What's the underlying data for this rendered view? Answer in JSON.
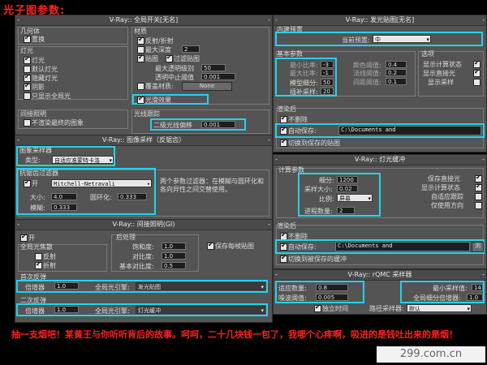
{
  "page_title": "光子图参数:",
  "global_switches": {
    "header": "V-Ray:: 全局开关[无名]",
    "geometry_group": "几何体",
    "displacement": "置换",
    "lights_group": "灯光",
    "lights": "灯光",
    "default_lights": "默认灯光",
    "hidden_lights": "隐藏灯光",
    "shadows": "阴影",
    "show_gi_only": "只显示全局光",
    "indirect_group": "间接照明",
    "no_render_final": "不渲染最终的图象",
    "materials_group": "材质",
    "reflect_refract": "反射/折射",
    "max_depth_label": "最大深度",
    "max_depth_value": "2",
    "maps": "贴图",
    "filter_maps": "过滤贴图",
    "max_transp_label": "最大透明级别",
    "max_transp_value": "50",
    "transp_cutoff_label": "透明中止阈值",
    "transp_cutoff_value": "0.001",
    "override_mtl": "覆盖材质:",
    "override_mtl_btn": "None",
    "glossy_effects": "光滑效果",
    "raytracing_group": "光线跟踪",
    "secondary_bias_label": "二级光线偏移",
    "secondary_bias_value": "0.001"
  },
  "image_sampler": {
    "header": "V-Ray:: 图像采样（反锯齿）",
    "sampler_group": "图象采样器",
    "type_label": "类型:",
    "type_value": "自适应准蒙特卡洛",
    "aa_group": "抗锯齿过滤器",
    "on_label": "开",
    "filter_value": "Mitchell-Netravali",
    "filter_desc": "两个参数过滤器：在模糊与圆环化和各向异性之间交替使用。",
    "size_label": "大小:",
    "size_value": "4.0",
    "ringing_label": "圆环化:",
    "ringing_value": "0.333",
    "blur_label": "模糊:",
    "blur_value": "0.333"
  },
  "indirect_illum": {
    "header": "V-Ray:: 间接照明(GI)",
    "on_label": "开",
    "caustics_group": "全局光焦散",
    "reflective": "反射",
    "refractive": "折射",
    "post_group": "后处理",
    "saturation_label": "饱和度:",
    "saturation_value": "1.0",
    "contrast_label": "对比度:",
    "contrast_value": "1.0",
    "contrast_base_label": "基本对比度:",
    "contrast_base_value": "0.5",
    "save_maps": "保存每帧贴图",
    "primary_group": "首次反弹",
    "primary_mult_label": "倍增器",
    "primary_mult_value": "1.0",
    "primary_engine_label": "全局光引擎:",
    "primary_engine_value": "发光贴图",
    "secondary_group": "二次反弹",
    "secondary_mult_label": "倍增器",
    "secondary_mult_value": "1.0",
    "secondary_engine_label": "全局光引擎:",
    "secondary_engine_value": "灯光缓冲"
  },
  "irradiance_map": {
    "header": "V-Ray:: 发光贴图[无名]",
    "builtin_group": "内建预置",
    "current_preset_label": "当前预置:",
    "current_preset_value": "中",
    "basic_group": "基本参数",
    "min_rate_label": "最小比率:",
    "min_rate_value": "-3",
    "max_rate_label": "最大比率:",
    "max_rate_value": "-1",
    "hsph_label": "模型细分:",
    "hsph_value": "50",
    "interp_label": "插补采样:",
    "interp_value": "20",
    "clr_thresh_label": "颜色阈值:",
    "clr_thresh_value": "0.4",
    "nrm_thresh_label": "法线阈值:",
    "nrm_thresh_value": "0.2",
    "dist_thresh_label": "间距阈值:",
    "dist_thresh_value": "0.1",
    "options_group": "选项",
    "show_calc": "显示计算状态",
    "show_direct": "显示直接光",
    "show_samples": "显示采样",
    "on_render_end_group": "渲染后",
    "dont_delete": "不删除",
    "auto_save_label": "自动保存:",
    "auto_save_path": "C:\\Documents and",
    "switch_saved": "切换到保存的贴图"
  },
  "light_cache": {
    "header": "V-Ray:: 灯光缓冲",
    "calc_group": "计算参数",
    "subdivs_label": "细分:",
    "subdivs_value": "1200",
    "sample_size_label": "采样大小:",
    "sample_size_value": "0.02",
    "scale_label": "比例:",
    "scale_value": "屏幕",
    "passes_label": "进程数量:",
    "passes_value": "2",
    "store_direct": "保存直接光",
    "show_calc": "显示计算状态",
    "adaptive": "自适应跟踪",
    "use_dirs": "仅使用方向",
    "on_render_end_group": "渲染后",
    "dont_delete": "不删除",
    "auto_save_label": "自动保存:",
    "auto_save_path": "C:\\Documents and",
    "browse_btn": "浏",
    "switch_saved": "切换到被保存的缓冲"
  },
  "rqmc": {
    "header": "V-Ray:: rQMC 采样器",
    "adaptive_label": "适应数量:",
    "adaptive_value": "0.8",
    "noise_label": "噪波阈值:",
    "noise_value": "0.005",
    "min_samples_label": "最小采样值:",
    "min_samples_value": "14",
    "global_mult_label": "全局细分倍增器:",
    "global_mult_value": "1.0",
    "time_indep": "独立时间",
    "path_sampler_label": "路径采样器:",
    "path_sampler_value": "默认"
  },
  "footer_text": "抽一支烟吧！某黄王与你听听背后的故事。呵呵，二十几块钱一包了，我哪个心疼啊，吸进的是钱吐出来的是烟！",
  "watermark": "299.com.cn",
  "colors": {
    "highlight": "#22d3ee",
    "title_red": "#ff2020",
    "panel": "#545454"
  }
}
